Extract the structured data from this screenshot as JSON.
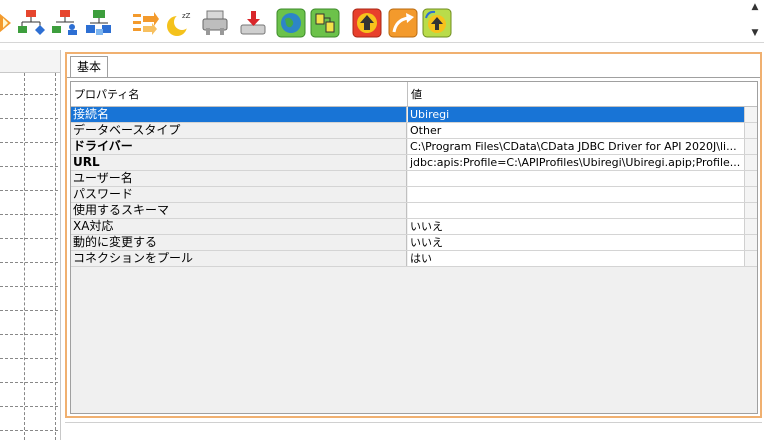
{
  "toolbar": {
    "icons": [
      "orange-partial-icon",
      "hierarchy-icon",
      "hierarchy-users-icon",
      "network-icon",
      "transfer-arrows-icon",
      "sleep-moon-icon",
      "printer-icon",
      "drive-import-icon",
      "globe-icon",
      "compare-icon",
      "upload-red-icon",
      "export-arrow-icon",
      "refresh-up-icon"
    ]
  },
  "properties": {
    "tab_label": "基本",
    "header_name": "プロパティ名",
    "header_value": "値",
    "rows": [
      {
        "name": "接続名",
        "value": "Ubiregi",
        "bold": false,
        "selected": true
      },
      {
        "name": "データベースタイプ",
        "value": "Other",
        "bold": false,
        "selected": false
      },
      {
        "name": "ドライバー",
        "value": "C:\\Program Files\\CData\\CData JDBC Driver for API 2020J\\li...",
        "bold": true,
        "selected": false
      },
      {
        "name": "URL",
        "value": "jdbc:apis:Profile=C:\\APIProfiles\\Ubiregi\\Ubiregi.apip;Profile...",
        "bold": true,
        "selected": false
      },
      {
        "name": "ユーザー名",
        "value": "",
        "bold": false,
        "selected": false
      },
      {
        "name": "パスワード",
        "value": "",
        "bold": false,
        "selected": false
      },
      {
        "name": "使用するスキーマ",
        "value": "",
        "bold": false,
        "selected": false
      },
      {
        "name": "XA対応",
        "value": "いいえ",
        "bold": false,
        "selected": false
      },
      {
        "name": "動的に変更する",
        "value": "いいえ",
        "bold": false,
        "selected": false
      },
      {
        "name": "コネクションをプール",
        "value": "はい",
        "bold": false,
        "selected": false
      }
    ]
  },
  "colors": {
    "selection": "#1874d6",
    "frame_accent": "#f0b070"
  }
}
